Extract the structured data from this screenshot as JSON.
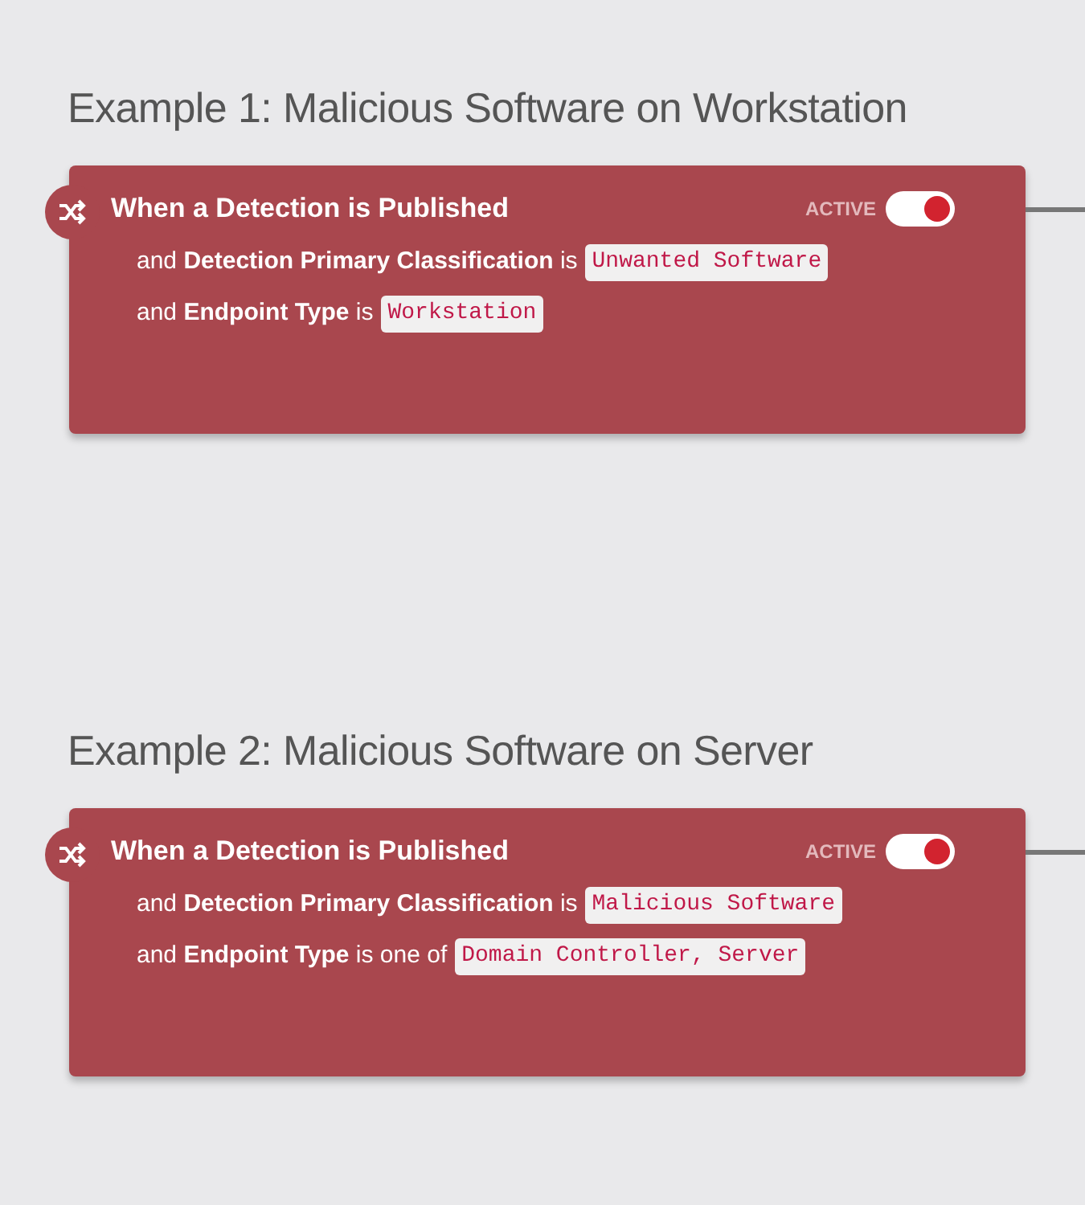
{
  "examples": [
    {
      "title": "Example 1: Malicious Software on Workstation",
      "trigger": "When a Detection is Published",
      "status_label": "ACTIVE",
      "active": true,
      "conditions": [
        {
          "text": "and **Detection Primary Classification** is",
          "value": "Unwanted Software"
        },
        {
          "text": "and **Endpoint Type** is",
          "value": "Workstation"
        }
      ]
    },
    {
      "title": "Example 2: Malicious Software on Server",
      "trigger": "When a Detection is Published",
      "status_label": "ACTIVE",
      "active": true,
      "conditions": [
        {
          "text": "and **Detection Primary Classification** is",
          "value": "Malicious Software"
        },
        {
          "text": "and **Endpoint Type** is one of",
          "value": "Domain Controller, Server"
        }
      ]
    }
  ]
}
